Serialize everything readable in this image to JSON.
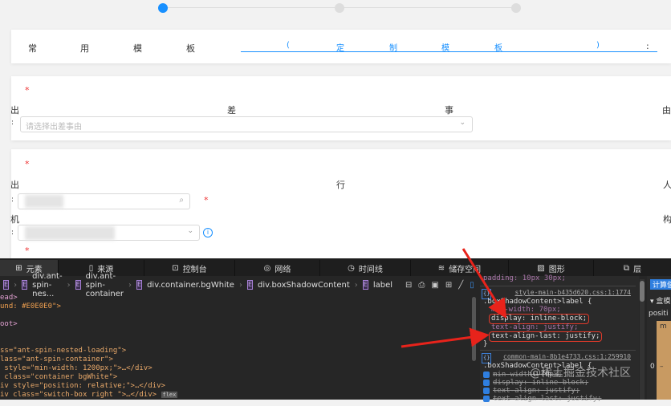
{
  "steps": {
    "count": 3,
    "current": 1
  },
  "template": {
    "label_chars": [
      "常",
      "用",
      "模",
      "板"
    ],
    "link_chars": [
      "(",
      "定",
      "制",
      "模",
      "板",
      ")"
    ],
    "colon": ":"
  },
  "reason": {
    "required": "*",
    "label_chars": [
      "出",
      "差",
      "事",
      "由"
    ],
    "colon": ":",
    "placeholder": "请选择出差事由"
  },
  "traveler": {
    "required": "*",
    "label_chars": [
      "出",
      "行",
      "人"
    ],
    "colon": ":"
  },
  "org": {
    "required": "*",
    "label_chars": [
      "机",
      "构"
    ],
    "colon": ":",
    "next_required": "*"
  },
  "devtools": {
    "tabs": [
      "元素",
      "来源",
      "控制台",
      "网络",
      "时间线",
      "储存空间",
      "图形",
      "层"
    ],
    "breadcrumb": [
      "div.ant-spin-nes...",
      "div.ant-spin-container",
      "div.container.bgWhite",
      "div.boxShadowContent",
      "label"
    ],
    "code_lines": [
      [
        "ead>",
        ""
      ],
      [
        "und: #E0E0E0\">",
        ""
      ],
      [
        "",
        ""
      ],
      [
        "oot>",
        ""
      ],
      [
        "",
        ""
      ],
      [
        "",
        ""
      ],
      [
        "ss=\"ant-spin-nested-loading\">",
        ""
      ],
      [
        "lass=\"ant-spin-container\">",
        ""
      ],
      [
        " style=\"min-width: 1200px;\">…</div>",
        ""
      ],
      [
        " class=\"container bgWhite\">",
        ""
      ],
      [
        "iv style=\"position: relative;\">…</div>",
        ""
      ],
      [
        "iv class=\"switch-box right \">…</div>",
        "flex"
      ]
    ],
    "styles": {
      "top_line": "padding: 10px 30px;",
      "rule1": {
        "source": "style-main-b435d620.css:1:1774",
        "selector": ".boxShadowContent>label {",
        "props": [
          "min-width: 70px;",
          "display: inline-block;",
          "text-align: justify;",
          "text-align-last: justify;"
        ],
        "close": "}"
      },
      "rule2": {
        "source": "common-main-8b1e4733.css:1:259910",
        "selector": ".boxShadowContent>label {",
        "props": [
          "min-width: 70px;",
          "display: inline-block;",
          "text-align: justify;",
          "text-align-last: justify;"
        ]
      }
    },
    "computed": {
      "tab": "计算值",
      "section": "盒模",
      "position_label": "positi",
      "margin_label": "m",
      "zero": "0",
      "dash": "–"
    },
    "watermark": "@稀土掘金技术社区"
  },
  "colors": {
    "accent": "#1890ff",
    "required": "#e33333",
    "highlight": "#e23a2a"
  }
}
